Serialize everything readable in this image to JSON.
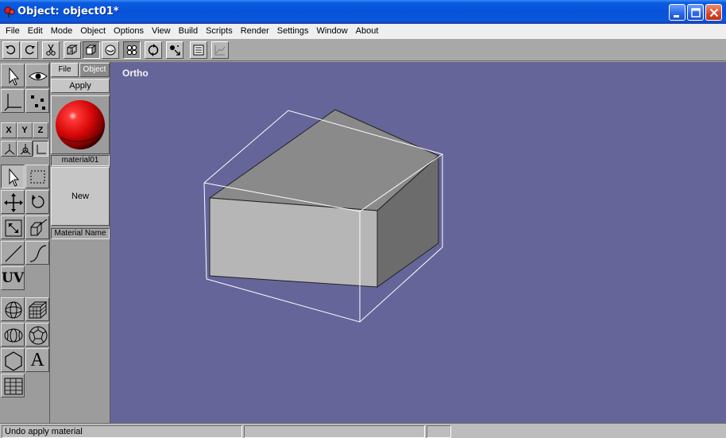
{
  "window": {
    "title": "Object: object01*"
  },
  "menu": [
    "File",
    "Edit",
    "Mode",
    "Object",
    "Options",
    "View",
    "Build",
    "Scripts",
    "Render",
    "Settings",
    "Window",
    "About"
  ],
  "toolbar": {
    "icons": [
      "undo-icon",
      "redo-icon",
      "cut-icon",
      "cube-wireframe-icon",
      "cube-flat-icon",
      "sphere-shaded-icon",
      "vertices-icon",
      "rotate-view-icon",
      "light-icon",
      "list-icon",
      "graph-icon"
    ]
  },
  "tools": {
    "axes": [
      "X",
      "Y",
      "Z"
    ],
    "uv_label": "UV",
    "text_label": "A"
  },
  "material_panel": {
    "tabs": [
      "File",
      "Object"
    ],
    "active_tab": "Object",
    "apply_label": "Apply",
    "material_name": "material01",
    "new_label": "New",
    "name_field_label": "Material Name",
    "swatch_color": "#e01010"
  },
  "viewport": {
    "view_label": "Ortho",
    "background": "#66659a"
  },
  "status": {
    "message": "Undo apply material",
    "cell2": "",
    "cell3": "",
    "cell4": ""
  }
}
